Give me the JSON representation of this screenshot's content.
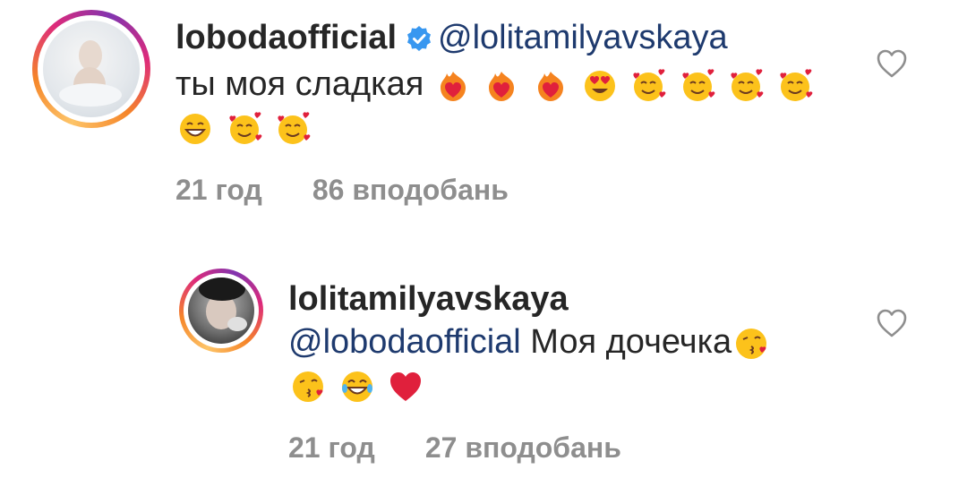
{
  "comments": [
    {
      "username": "lobodaofficial",
      "verified": true,
      "mention": "@lolitamilyavskaya",
      "text": "ты моя сладкая",
      "emojis_line1": [
        "heart-on-fire-emoji",
        "heart-on-fire-emoji",
        "heart-on-fire-emoji",
        "heart-eyes-emoji",
        "smiling-face-with-hearts-emoji",
        "smiling-face-with-hearts-emoji",
        "smiling-face-with-hearts-emoji",
        "smiling-face-with-hearts-emoji"
      ],
      "emojis_line2": [
        "grinning-face-emoji",
        "smiling-face-with-hearts-emoji",
        "smiling-face-with-hearts-emoji"
      ],
      "time": "21 год",
      "likes": "86 вподобань",
      "like_icon": "heart-outline-icon"
    },
    {
      "username": "lolitamilyavskaya",
      "verified": false,
      "mention": "@lobodaofficial",
      "text": "Моя дочечка",
      "emojis_line1": [
        "kissing-face-emoji"
      ],
      "emojis_line2": [
        "kissing-face-emoji",
        "tears-of-joy-emoji",
        "red-heart-emoji"
      ],
      "time": "21 год",
      "likes": "27 вподобань",
      "like_icon": "heart-outline-icon"
    }
  ],
  "colors": {
    "mention": "#1e3a6e",
    "meta": "#8e8e8e",
    "verified": "#3897f0"
  }
}
